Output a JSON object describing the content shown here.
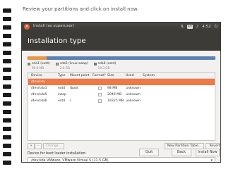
{
  "instruction": "Review your partitions and click on install now.",
  "window": {
    "title": "Install (as superuser)",
    "close_glyph": "×",
    "tray": {
      "keyboard": "En",
      "volume_icon": "speaker-icon",
      "time": "4:52"
    }
  },
  "page_title": "Installation type",
  "partition_bar": {
    "segments": [
      {
        "name": "sda1 (ext4)",
        "size": "99.6 MB",
        "color": "#77a33b",
        "fraction": 0.005
      },
      {
        "name": "sda5 (linux-swap)",
        "size": "2.0 GB",
        "color": "#e8974a",
        "fraction": 0.095
      },
      {
        "name": "sda6 (ext4)",
        "size": "19.3 GB",
        "color": "#5a82b4",
        "fraction": 0.9
      }
    ]
  },
  "table": {
    "headers": [
      "Device",
      "Type",
      "Mount point",
      "Format?",
      "Size",
      "Used",
      "System"
    ],
    "rows": [
      {
        "device": "/dev/sda",
        "type": "",
        "mount": "",
        "format": "",
        "size": "",
        "used": "",
        "selected": true
      },
      {
        "device": "/dev/sda1",
        "type": "ext4",
        "mount": "/boot",
        "format": "☐",
        "size": "98 MB",
        "used": "unknown",
        "selected": false
      },
      {
        "device": "/dev/sda5",
        "type": "swap",
        "mount": "",
        "format": "☐",
        "size": "2046 MB",
        "used": "unknown",
        "selected": false
      },
      {
        "device": "/dev/sda6",
        "type": "ext4",
        "mount": "/",
        "format": "☐",
        "size": "19325 MB",
        "used": "unknown",
        "selected": false
      }
    ]
  },
  "toolbar": {
    "add": "+",
    "remove": "−",
    "change": "Change...",
    "new_table": "New Partition Table...",
    "revert": "Revert"
  },
  "boot": {
    "label": "Device for boot loader installation:",
    "value": "/dev/sda   VMware, VMware Virtual S (21.5 GB)"
  },
  "buttons": {
    "quit": "Quit",
    "back": "Back",
    "install": "Install Now"
  },
  "colors": {
    "header_bg": "#3c3b37",
    "selected_row": "#f07746",
    "window_bg": "#f2f1f0"
  }
}
